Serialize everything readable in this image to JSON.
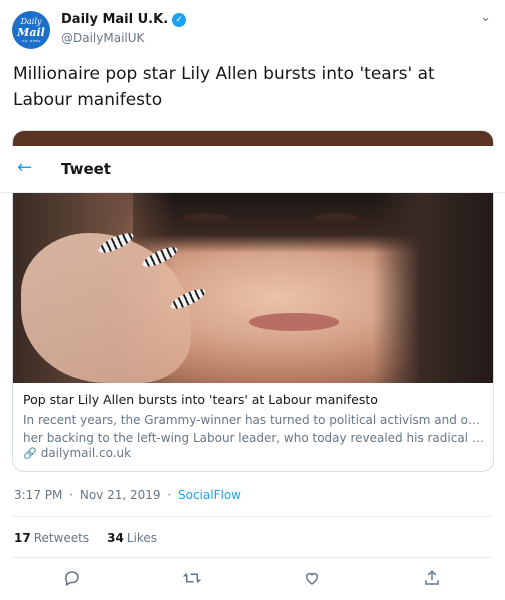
{
  "account": {
    "avatar_line1": "Daily",
    "avatar_line2": "Mail",
    "avatar_line3": "U.K. NEWS",
    "name": "Daily Mail U.K.",
    "handle": "@DailyMailUK",
    "verified_icon": "✓"
  },
  "tweet": {
    "text": "Millionaire pop star Lily Allen bursts into 'tears' at Labour manifesto"
  },
  "overlay": {
    "back_icon": "←",
    "title": "Tweet"
  },
  "card": {
    "title": "Pop star Lily Allen bursts into 'tears' at Labour manifesto",
    "desc_line1": "In recent years, the Grammy-winner has turned to political activism and offered",
    "desc_line2": "her backing to the left-wing Labour leader, who today revealed his radical visi…",
    "link_icon": "🔗",
    "domain": "dailymail.co.uk"
  },
  "meta": {
    "time": "3:17 PM",
    "dot1": "·",
    "date": "Nov 21, 2019",
    "dot2": "·",
    "source": "SocialFlow"
  },
  "stats": {
    "retweets_count": "17",
    "retweets_label": "Retweets",
    "likes_count": "34",
    "likes_label": "Likes"
  },
  "icons": {
    "caret": "⌄",
    "reply": "◯",
    "retweet": "⇄",
    "like": "♡",
    "share": "⇪"
  },
  "colors": {
    "accent": "#1da1f2",
    "text": "#14171a",
    "muted": "#657786"
  }
}
